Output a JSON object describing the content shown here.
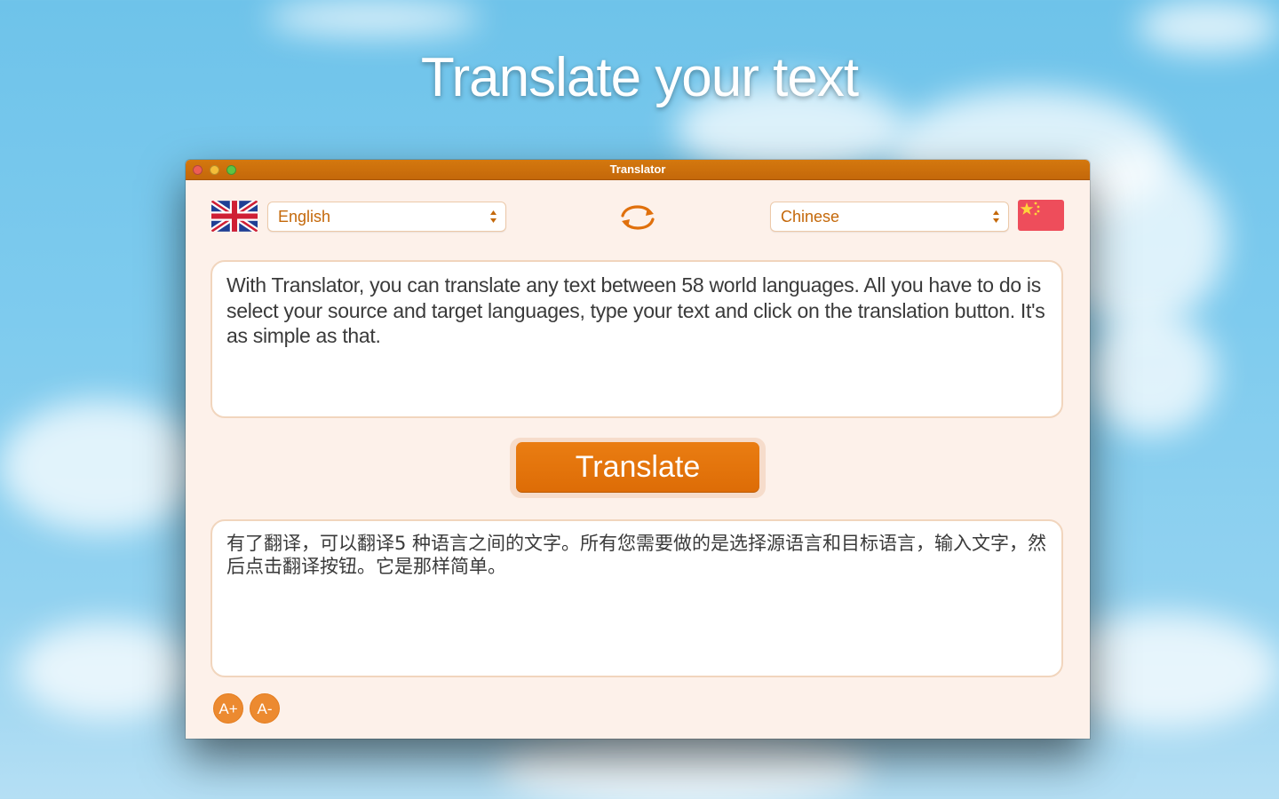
{
  "headline": "Translate your text",
  "window": {
    "title": "Translator"
  },
  "source": {
    "language": "English"
  },
  "target": {
    "language": "Chinese"
  },
  "input_text": "With Translator, you can translate any text between 58 world languages.  All you have to do is select your source and target languages, type your text and click on the translation button. It's as simple as that.",
  "translate_label": "Translate",
  "output_text": "有了翻译，可以翻译5 种语言之间的文字。所有您需要做的是选择源语言和目标语言，输入文字，然后点击翻译按钮。它是那样简单。",
  "font_controls": {
    "increase_label": "A+",
    "decrease_label": "A-"
  },
  "colors": {
    "accent": "#dd6c06",
    "titlebar": "#c8700c",
    "window_bg": "#fdf1ea"
  }
}
